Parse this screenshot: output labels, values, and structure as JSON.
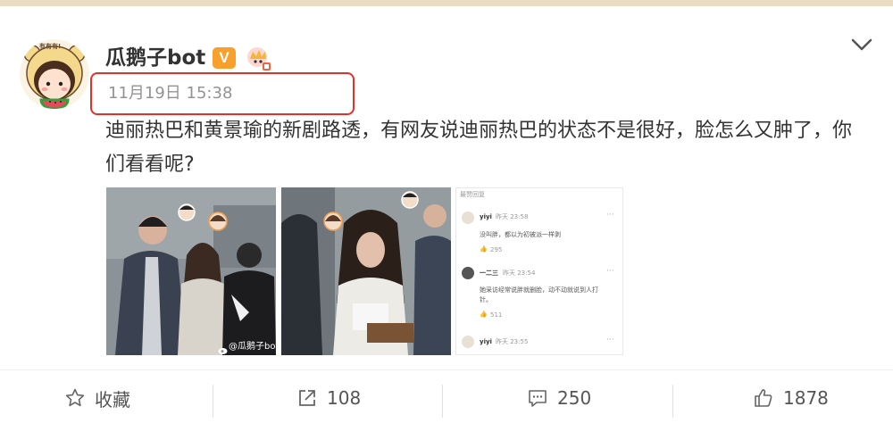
{
  "post": {
    "username": "瓜鹅子bot",
    "vip_badge": "V",
    "timestamp": "11月19日 15:38",
    "text": "迪丽热巴和黄景瑜的新剧路透，有网友说迪丽热巴的状态不是很好，脸怎么又肿了，你们看看呢?",
    "watermark": "@瓜鹅子bot"
  },
  "avatar_badge_text": "有有有!",
  "comments_screenshot": {
    "header": "最赞回复",
    "comments": [
      {
        "user": "yiyi",
        "meta": "昨天 23:58",
        "text": "没叫胖，都以为初被派一样剥",
        "likes": "295"
      },
      {
        "user": "一二三",
        "meta": "昨天 23:54",
        "text": "她采访经常说胖就删脸，动不动就说到人打",
        "text2": "针。",
        "likes": "511"
      },
      {
        "user": "yiyi",
        "meta": "昨天 23:55",
        "text": "",
        "likes": ""
      }
    ]
  },
  "actions": {
    "favorite": "收藏",
    "share_count": "108",
    "comment_count": "250",
    "like_count": "1878"
  },
  "colors": {
    "highlight_border": "#e0312b",
    "vip_orange": "#f7a02b",
    "top_strip": "#eadcc3"
  }
}
